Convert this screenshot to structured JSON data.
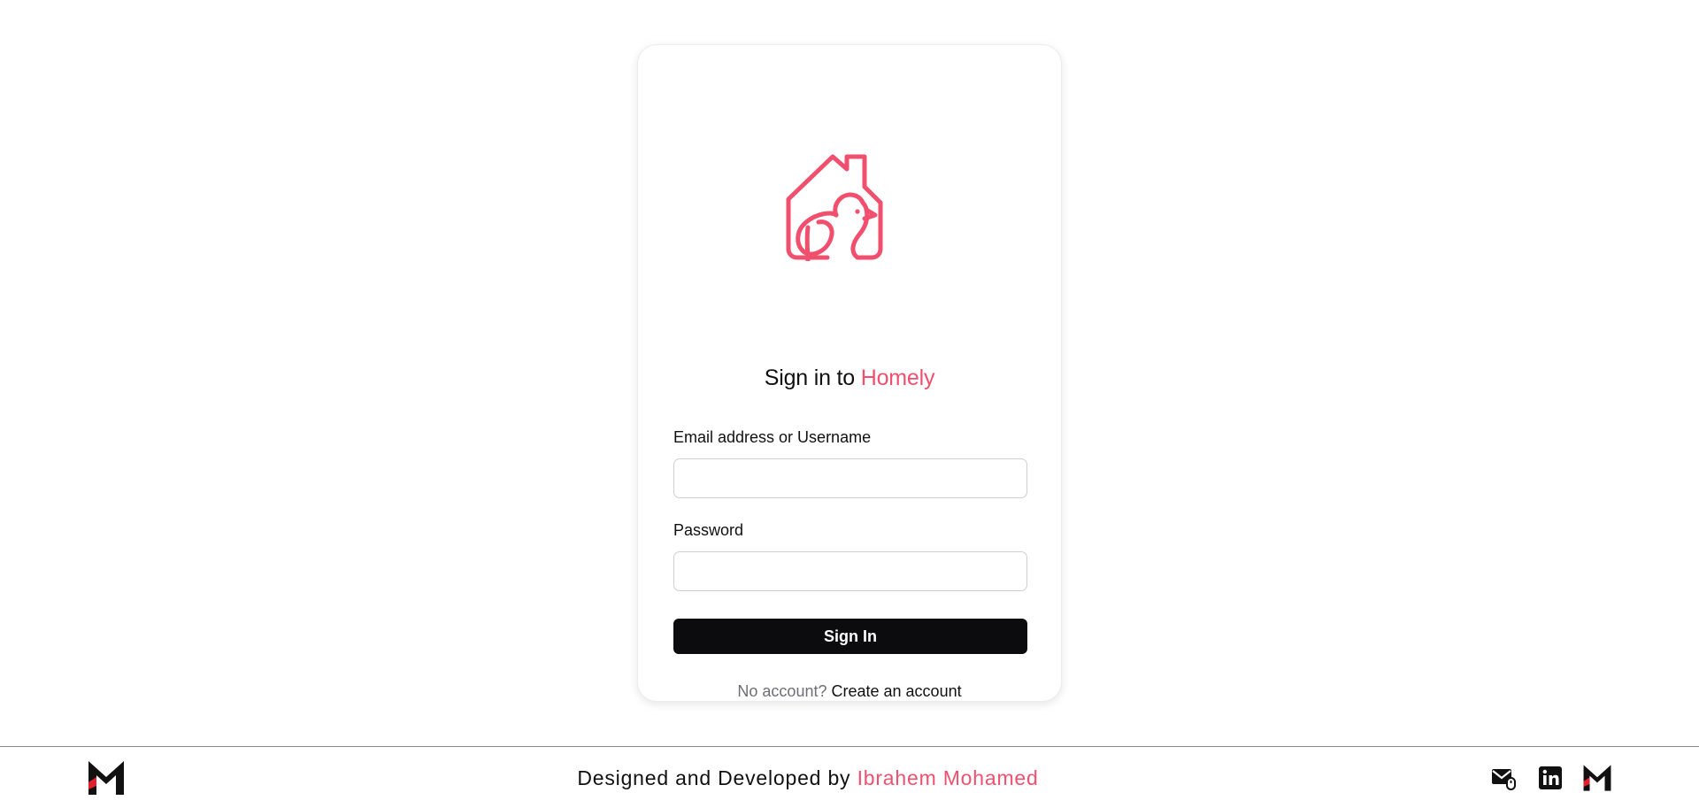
{
  "login": {
    "heading_prefix": "Sign in to ",
    "brand_name": "Homely",
    "email_label": "Email address or Username",
    "email_value": "",
    "password_label": "Password",
    "password_value": "",
    "signin_label": "Sign In",
    "no_account_text": "No account?",
    "create_account_link": "Create an account",
    "logo_icon": "house-bird-logo-icon"
  },
  "footer": {
    "credit_prefix": "Designed and Developed by ",
    "author_name": "Ibrahem Mohamed",
    "icons": [
      "m-logo-icon",
      "mail-icon",
      "linkedin-icon",
      "m-logo-icon"
    ]
  },
  "colors": {
    "accent": "#f0506e",
    "button": "#0c0c0e",
    "text": "#111111",
    "muted": "#6e6e76"
  }
}
